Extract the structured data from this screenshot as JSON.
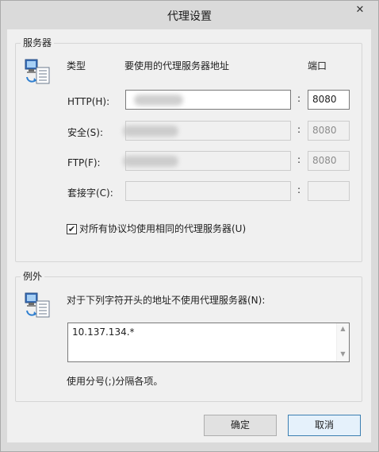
{
  "window": {
    "title": "代理设置",
    "close_glyph": "✕"
  },
  "servers": {
    "group_title": "服务器",
    "icon": "network-computer-icon",
    "col_type": "类型",
    "col_address": "要使用的代理服务器地址",
    "col_port": "端口",
    "rows": [
      {
        "label": "HTTP(H):",
        "port": "8080",
        "enabled": true
      },
      {
        "label": "安全(S):",
        "port": "8080",
        "enabled": false
      },
      {
        "label": "FTP(F):",
        "port": "8080",
        "enabled": false
      },
      {
        "label": "套接字(C):",
        "port": "",
        "enabled": false
      }
    ],
    "colon": ":",
    "same_proxy_label": "对所有协议均使用相同的代理服务器(U)",
    "same_proxy_checked": true
  },
  "exceptions": {
    "group_title": "例外",
    "icon": "network-computer-icon",
    "prompt": "对于下列字符开头的地址不使用代理服务器(N):",
    "value": "10.137.134.*",
    "hint": "使用分号(;)分隔各项。"
  },
  "buttons": {
    "ok": "确定",
    "cancel": "取消"
  },
  "colors": {
    "dialog_bg": "#f0f0f0",
    "frame": "#dadada",
    "default_button_border": "#3c7fb1"
  }
}
